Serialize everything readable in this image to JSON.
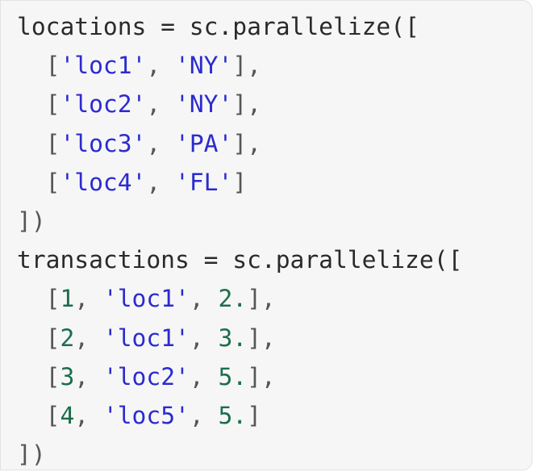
{
  "code": {
    "language": "python",
    "lines": [
      [
        {
          "t": "locations = sc.parallelize([",
          "k": "plain"
        }
      ],
      [
        {
          "t": "  [",
          "k": "punc"
        },
        {
          "t": "'loc1'",
          "k": "str"
        },
        {
          "t": ", ",
          "k": "punc"
        },
        {
          "t": "'NY'",
          "k": "str"
        },
        {
          "t": "],",
          "k": "punc"
        }
      ],
      [
        {
          "t": "  [",
          "k": "punc"
        },
        {
          "t": "'loc2'",
          "k": "str"
        },
        {
          "t": ", ",
          "k": "punc"
        },
        {
          "t": "'NY'",
          "k": "str"
        },
        {
          "t": "],",
          "k": "punc"
        }
      ],
      [
        {
          "t": "  [",
          "k": "punc"
        },
        {
          "t": "'loc3'",
          "k": "str"
        },
        {
          "t": ", ",
          "k": "punc"
        },
        {
          "t": "'PA'",
          "k": "str"
        },
        {
          "t": "],",
          "k": "punc"
        }
      ],
      [
        {
          "t": "  [",
          "k": "punc"
        },
        {
          "t": "'loc4'",
          "k": "str"
        },
        {
          "t": ", ",
          "k": "punc"
        },
        {
          "t": "'FL'",
          "k": "str"
        },
        {
          "t": "]",
          "k": "punc"
        }
      ],
      [
        {
          "t": "])",
          "k": "punc"
        }
      ],
      [
        {
          "t": "transactions = sc.parallelize([",
          "k": "plain"
        }
      ],
      [
        {
          "t": "  [",
          "k": "punc"
        },
        {
          "t": "1",
          "k": "num"
        },
        {
          "t": ", ",
          "k": "punc"
        },
        {
          "t": "'loc1'",
          "k": "str"
        },
        {
          "t": ", ",
          "k": "punc"
        },
        {
          "t": "2.",
          "k": "num"
        },
        {
          "t": "],",
          "k": "punc"
        }
      ],
      [
        {
          "t": "  [",
          "k": "punc"
        },
        {
          "t": "2",
          "k": "num"
        },
        {
          "t": ", ",
          "k": "punc"
        },
        {
          "t": "'loc1'",
          "k": "str"
        },
        {
          "t": ", ",
          "k": "punc"
        },
        {
          "t": "3.",
          "k": "num"
        },
        {
          "t": "],",
          "k": "punc"
        }
      ],
      [
        {
          "t": "  [",
          "k": "punc"
        },
        {
          "t": "3",
          "k": "num"
        },
        {
          "t": ", ",
          "k": "punc"
        },
        {
          "t": "'loc2'",
          "k": "str"
        },
        {
          "t": ", ",
          "k": "punc"
        },
        {
          "t": "5.",
          "k": "num"
        },
        {
          "t": "],",
          "k": "punc"
        }
      ],
      [
        {
          "t": "  [",
          "k": "punc"
        },
        {
          "t": "4",
          "k": "num"
        },
        {
          "t": ", ",
          "k": "punc"
        },
        {
          "t": "'loc5'",
          "k": "str"
        },
        {
          "t": ", ",
          "k": "punc"
        },
        {
          "t": "5.",
          "k": "num"
        },
        {
          "t": "]",
          "k": "punc"
        }
      ],
      [
        {
          "t": "])",
          "k": "punc"
        }
      ]
    ]
  },
  "colors": {
    "background": "#f6f6f6",
    "string": "#2b2bd0",
    "number": "#1b6e4b",
    "text": "#2a2a2a",
    "punctuation": "#555555"
  }
}
